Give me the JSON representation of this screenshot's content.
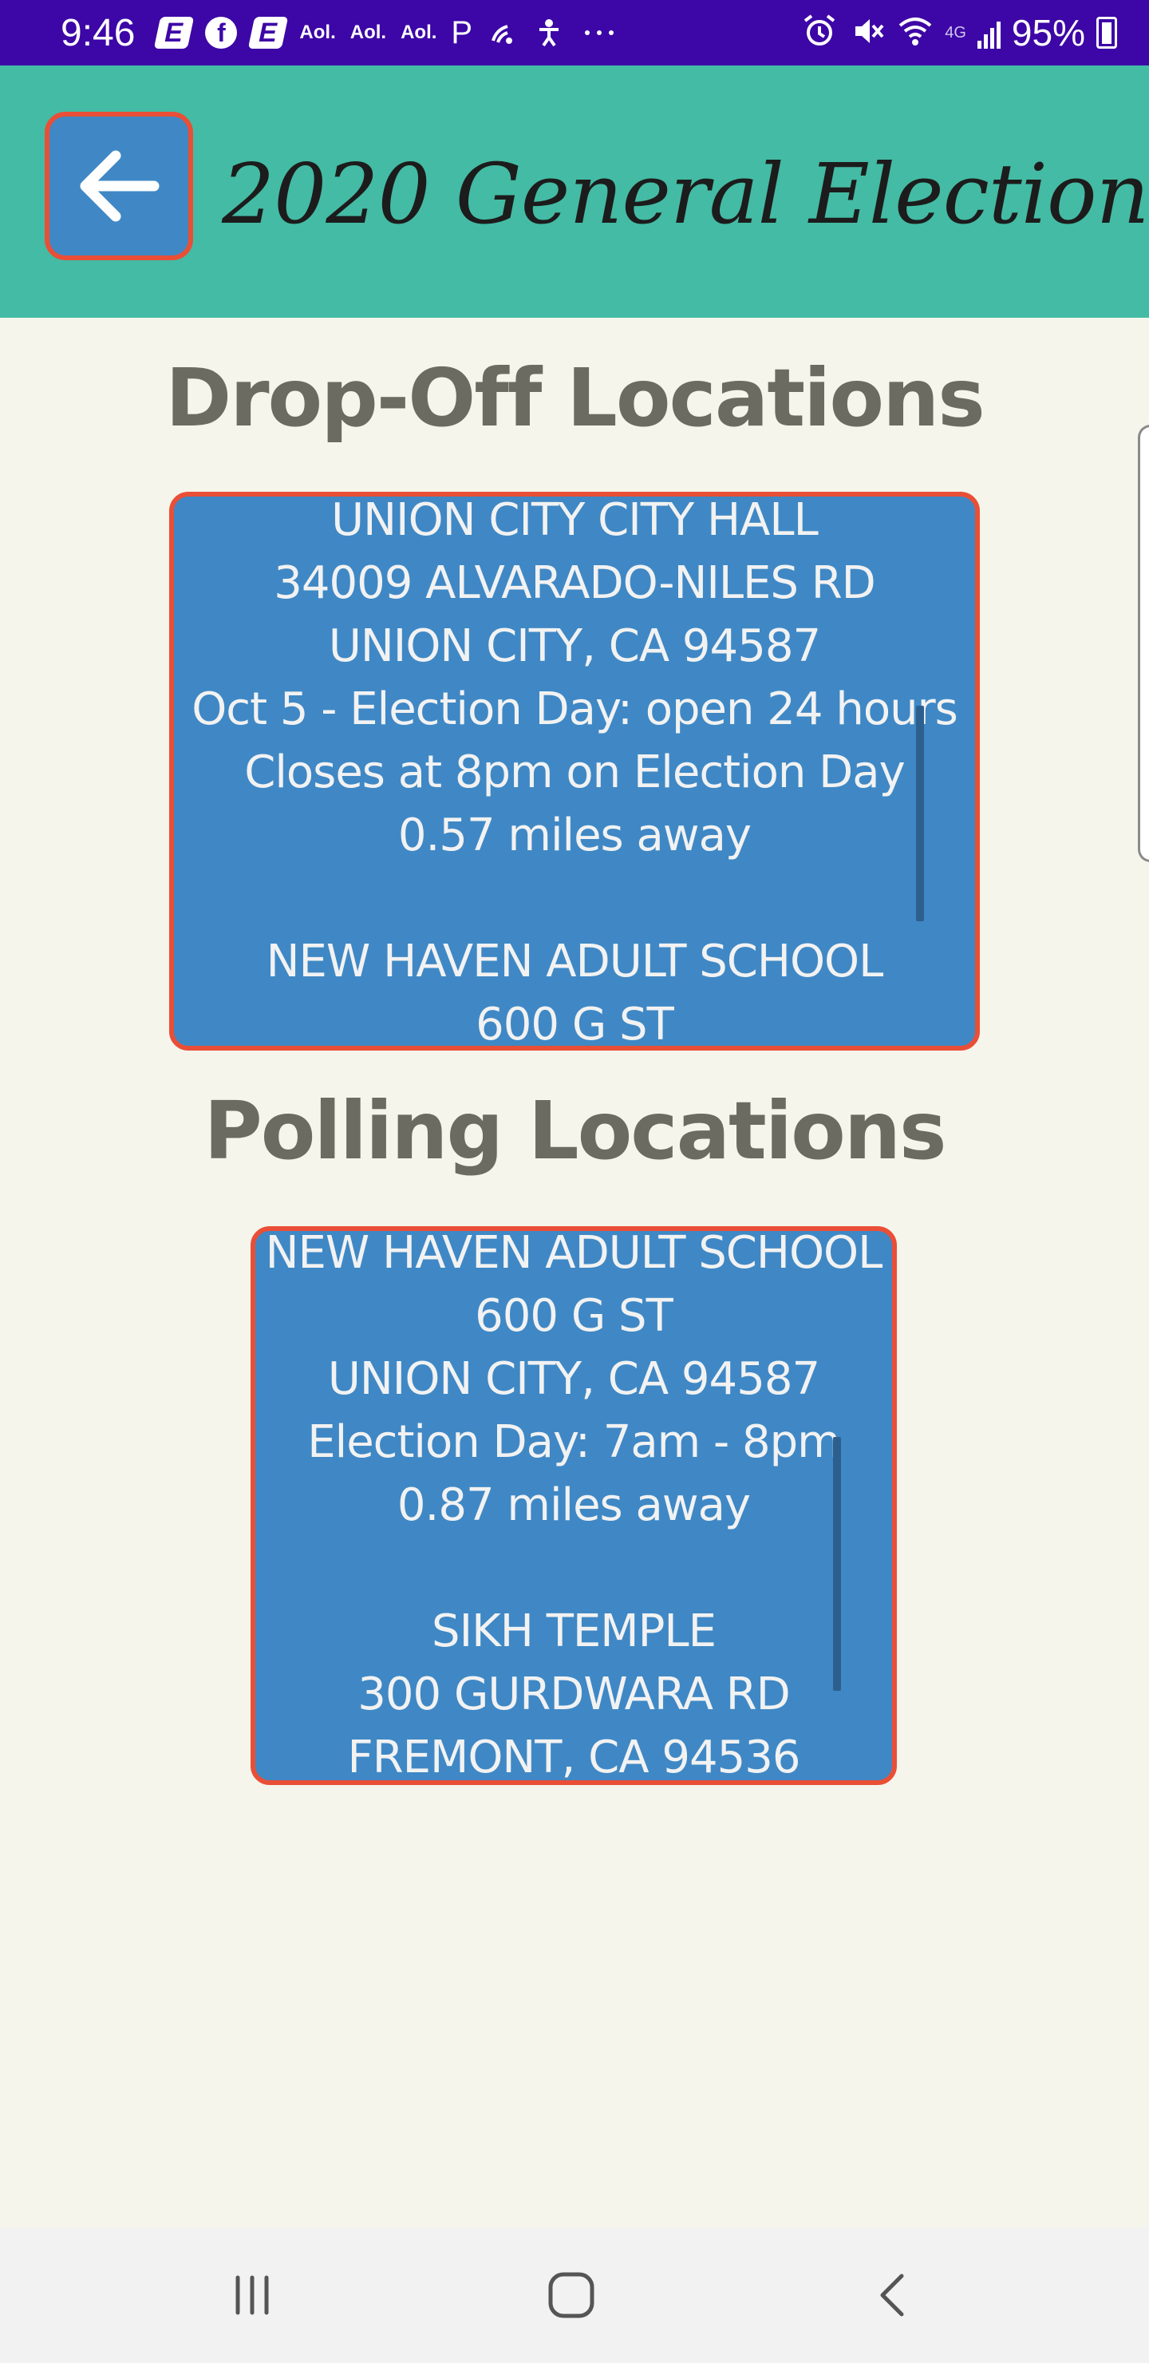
{
  "status_bar": {
    "time": "9:46",
    "left_icons": [
      "E",
      "f",
      "E",
      "Aol.",
      "Aol.",
      "Aol.",
      "P"
    ],
    "battery_text": "95%",
    "network": "4G"
  },
  "app_bar": {
    "title": "2020 General Election",
    "back_icon": "arrow-left-icon"
  },
  "dropoff": {
    "heading": "Drop-Off Locations",
    "lines": [
      "UNION CITY CITY HALL",
      "34009 ALVARADO-NILES RD",
      "UNION CITY, CA 94587",
      "Oct 5 - Election Day: open 24 hours",
      "Closes at 8pm on Election Day",
      "0.57 miles away",
      "",
      "NEW HAVEN ADULT SCHOOL",
      "600 G ST"
    ]
  },
  "polling": {
    "heading": "Polling Locations",
    "lines": [
      "NEW HAVEN ADULT SCHOOL",
      "600 G ST",
      "UNION CITY, CA 94587",
      "Election Day: 7am - 8pm",
      "0.87 miles away",
      "",
      "SIKH TEMPLE",
      "300 GURDWARA RD",
      "FREMONT, CA 94536"
    ]
  },
  "colors": {
    "status_bar": "#3d06a6",
    "app_bar": "#44bba4",
    "card": "#3f88c5",
    "card_border": "#e94f37",
    "background": "#f5f5eb",
    "heading": "#6b6b61"
  },
  "nav_bar": {
    "icons": [
      "recent-apps-icon",
      "home-icon",
      "back-nav-icon"
    ]
  }
}
